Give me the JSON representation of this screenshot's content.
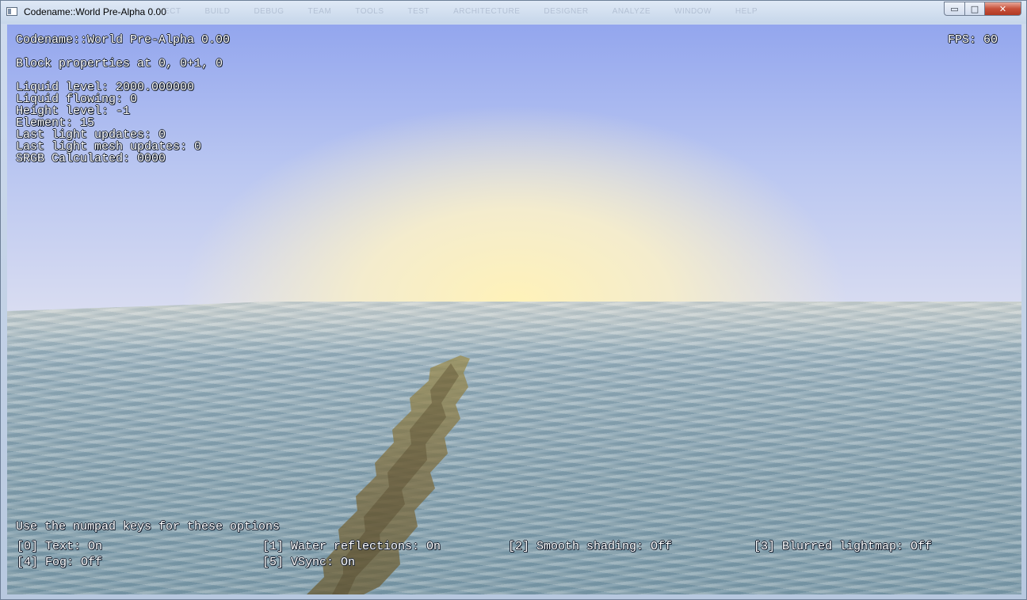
{
  "window": {
    "title": "Codename::World Pre-Alpha 0.00",
    "ghost_menu": [
      "ECT",
      "BUILD",
      "DEBUG",
      "TEAM",
      "TOOLS",
      "TEST",
      "ARCHITECTURE",
      "DESIGNER",
      "ANALYZE",
      "WINDOW",
      "HELP"
    ],
    "controls": {
      "minimize": "▭",
      "maximize": "□",
      "close": "✕"
    }
  },
  "hud": {
    "title": "Codename::World Pre-Alpha 0.00",
    "fps": "FPS: 60",
    "block_props": "Block properties at 0, 0+1, 0",
    "liquid_level": "Liquid level: 2000.000000",
    "liquid_flowing": "Liquid flowing: 0",
    "height_level": "Height level: -1",
    "element": "Element: 15",
    "last_light_updates": "Last light updates: 0",
    "last_light_mesh_updates": "Last light mesh updates: 0",
    "srgb": "SRGB Calculated: 0000"
  },
  "options": {
    "heading": "Use the numpad keys for these options",
    "items": [
      "[0] Text: On",
      "[1] Water reflections: On",
      "[2] Smooth shading: Off",
      "[3] Blurred lightmap: Off",
      "[4] Fog: Off",
      "[5] VSync: On"
    ]
  }
}
